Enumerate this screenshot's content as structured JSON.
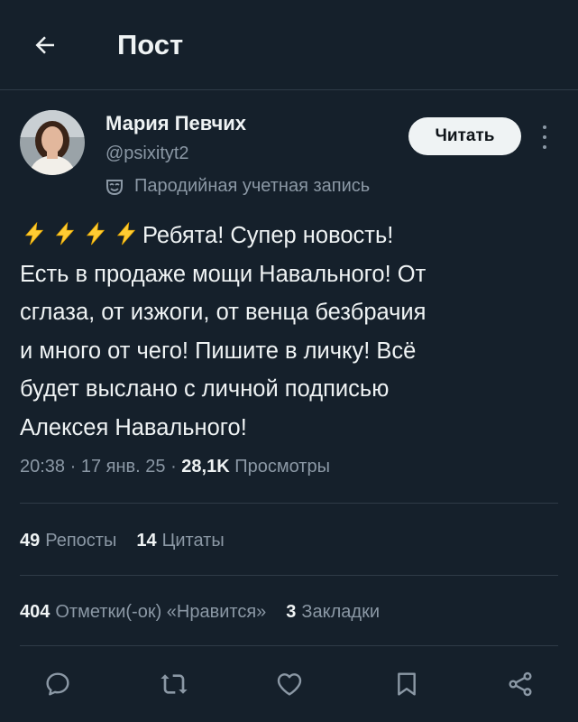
{
  "header": {
    "title": "Пост",
    "back_icon": "arrow-left-icon"
  },
  "author": {
    "name": "Мария Певчих",
    "handle": "@psixityt2",
    "parody_label": "Пародийная учетная запись",
    "parody_icon": "mask-icon"
  },
  "follow_label": "Читать",
  "tweet": {
    "emoji": "⚡⚡⚡⚡",
    "lines": [
      "Ребята! Супер новость!",
      "Есть в продаже мощи Навального! От",
      "сглаза, от изжоги, от венца безбрачия",
      "и много от чего! Пишите в личку! Всё",
      "будет выслано с личной подписью",
      "Алексея Навального!"
    ]
  },
  "meta": {
    "time": "20:38",
    "date": "17 янв. 25",
    "views_count": "28,1K",
    "views_label": "Просмотры",
    "separator": " · "
  },
  "stats": {
    "reposts_count": "49",
    "reposts_label": "Репосты",
    "quotes_count": "14",
    "quotes_label": "Цитаты",
    "likes_count": "404",
    "likes_label": "Отметки(-ок) «Нравится»",
    "bookmarks_count": "3",
    "bookmarks_label": "Закладки"
  },
  "actions": [
    "reply-icon",
    "retweet-icon",
    "like-icon",
    "bookmark-icon",
    "share-icon"
  ],
  "colors": {
    "background": "#15202b",
    "text_primary": "#eff3f4",
    "text_secondary": "#8b98a5",
    "divider": "#2f3b47",
    "bolt": "#ffcc33"
  }
}
